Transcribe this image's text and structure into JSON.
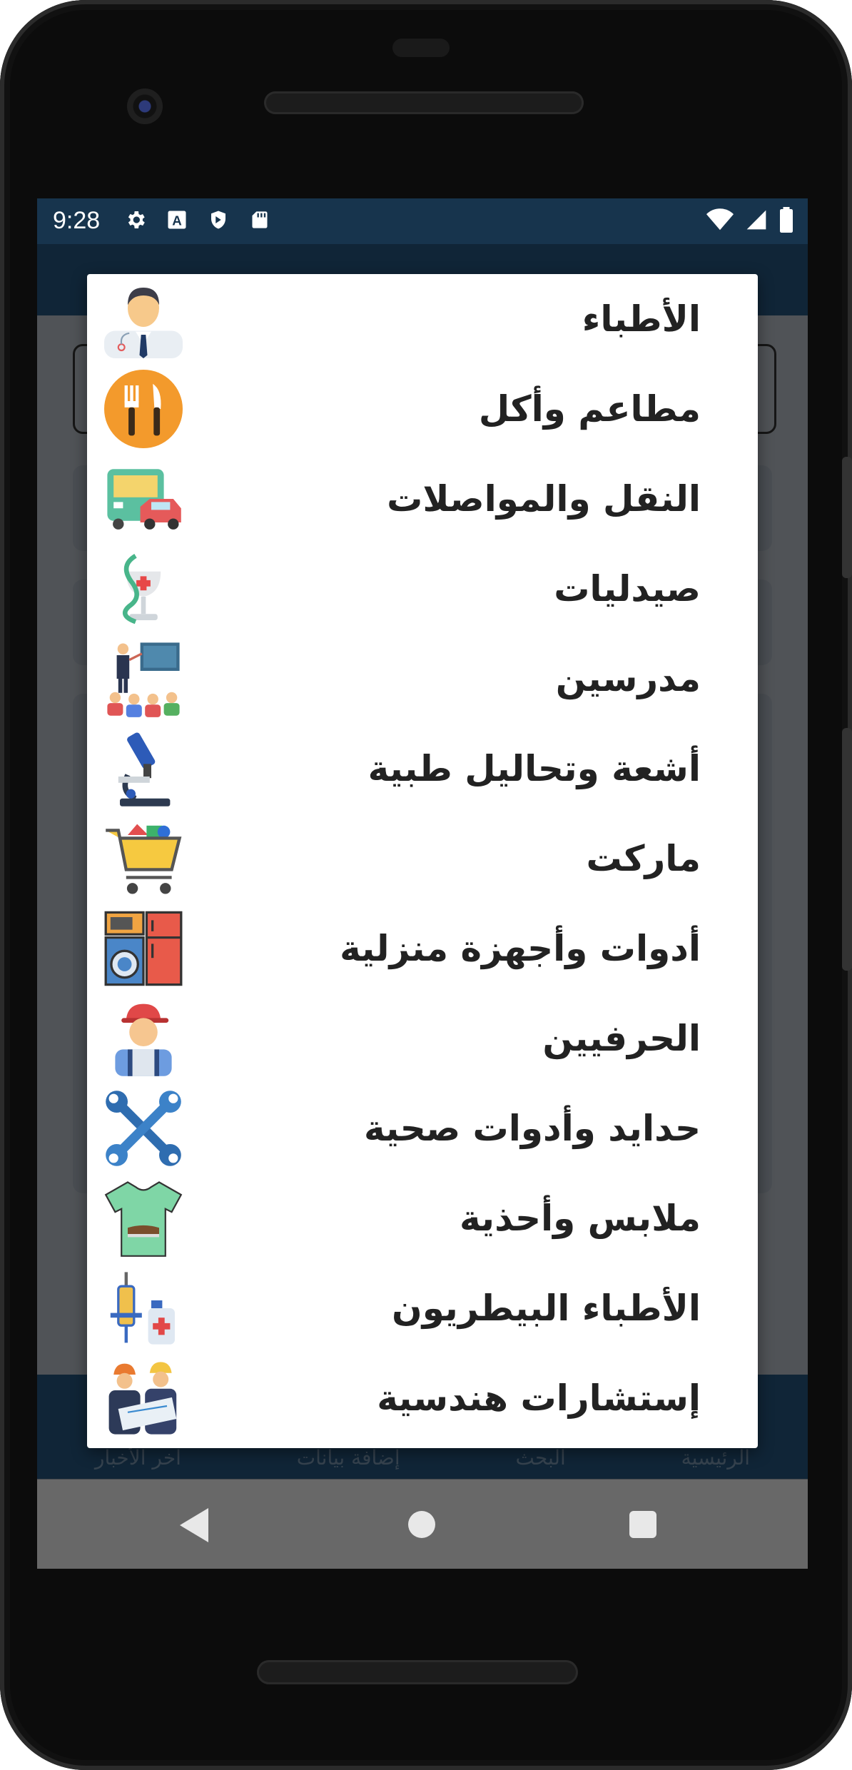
{
  "status_bar": {
    "time": "9:28",
    "left_icons": [
      "gear-icon",
      "a-icon",
      "shield-icon",
      "sd-card-icon"
    ],
    "right_icons": [
      "wifi-icon",
      "signal-icon",
      "battery-icon"
    ]
  },
  "bottom_nav": {
    "items": [
      "الرئيسية",
      "البحث",
      "إضافة بيانات",
      "آخر الأخبار"
    ]
  },
  "menu": {
    "items": [
      {
        "label": "الأطباء",
        "icon": "doctor-icon"
      },
      {
        "label": "مطاعم وأكل",
        "icon": "restaurant-icon"
      },
      {
        "label": "النقل والمواصلات",
        "icon": "transport-icon"
      },
      {
        "label": "صيدليات",
        "icon": "pharmacy-icon"
      },
      {
        "label": "مدرسين",
        "icon": "teacher-icon"
      },
      {
        "label": "أشعة وتحاليل طبية",
        "icon": "microscope-icon"
      },
      {
        "label": "ماركت",
        "icon": "cart-icon"
      },
      {
        "label": "أدوات وأجهزة منزلية",
        "icon": "appliances-icon"
      },
      {
        "label": "الحرفيين",
        "icon": "worker-icon"
      },
      {
        "label": "حدايد وأدوات صحية",
        "icon": "tools-icon"
      },
      {
        "label": "ملابس وأحذية",
        "icon": "clothes-icon"
      },
      {
        "label": "الأطباء البيطريون",
        "icon": "vet-icon"
      },
      {
        "label": "إستشارات هندسية",
        "icon": "engineer-icon"
      }
    ]
  },
  "colors": {
    "status_bar": "#17344d",
    "app_bar": "#1a3a55",
    "dialog_bg": "#ffffff",
    "label_text": "#222222"
  }
}
